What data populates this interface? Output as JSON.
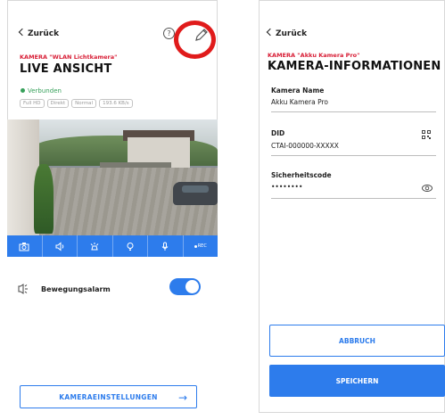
{
  "left_screen": {
    "back_label": "Zurück",
    "help_icon_glyph": "?",
    "camera_label": "KAMERA \"WLAN Lichtkamera\"",
    "title": "LIVE ANSICHT",
    "status": "Verbunden",
    "badges": [
      "Full HD",
      "Direkt",
      "Normal",
      "193.6 KB/s"
    ],
    "controls": [
      {
        "icon": "snapshot-icon"
      },
      {
        "icon": "speaker-icon"
      },
      {
        "icon": "light-icon"
      },
      {
        "icon": "bulb-icon"
      },
      {
        "icon": "microphone-icon"
      },
      {
        "icon": "record-icon",
        "label": "REC"
      }
    ],
    "alarm_label": "Bewegungsalarm",
    "alarm_enabled": true,
    "settings_button": "KAMERAEINSTELLUNGEN"
  },
  "right_screen": {
    "back_label": "Zurück",
    "camera_label": "KAMERA \"Akku Kamera Pro\"",
    "title": "KAMERA-INFORMATIONEN",
    "name_label": "Kamera Name",
    "name_value": "Akku Kamera Pro",
    "did_label": "DID",
    "did_value": "CTAI-000000-XXXXX",
    "code_label": "Sicherheitscode",
    "code_value": "••••••••",
    "cancel_button": "ABBRUCH",
    "save_button": "SPEICHERN"
  },
  "colors": {
    "accent": "#2d7cec",
    "camera_label": "#d81e36",
    "status_ok": "#36a05a",
    "highlight_circle": "#e01b1b"
  }
}
